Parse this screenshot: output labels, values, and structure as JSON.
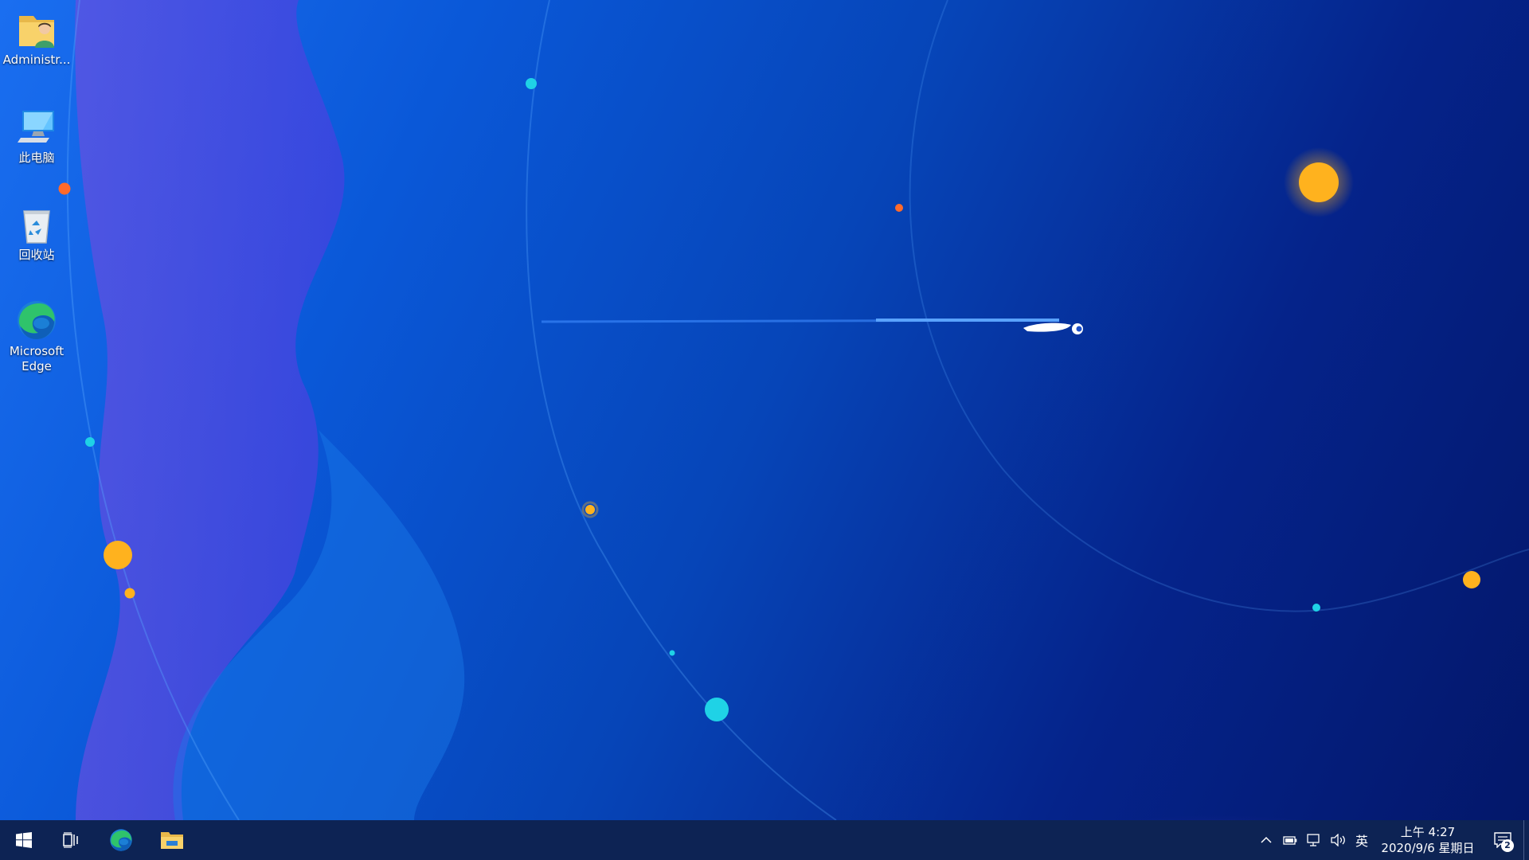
{
  "desktop": {
    "icons": [
      {
        "label": "Administr...",
        "icon": "user-folder-icon"
      },
      {
        "label": "此电脑",
        "icon": "this-pc-icon"
      },
      {
        "label": "回收站",
        "icon": "recycle-bin-icon"
      },
      {
        "label": "Microsoft Edge",
        "icon": "edge-icon"
      }
    ]
  },
  "taskbar": {
    "start": {
      "icon": "windows-logo-icon"
    },
    "task_view": {
      "icon": "task-view-icon"
    },
    "pinned": [
      {
        "icon": "edge-icon"
      },
      {
        "icon": "file-explorer-icon"
      }
    ],
    "tray": {
      "ime": "英",
      "time": "上午 4:27",
      "date": "2020/9/6 星期日",
      "notification_count": "2"
    }
  },
  "colors": {
    "taskbar": "#0d2354",
    "accent_orange": "#ffb21e",
    "accent_cyan": "#1fd2e6"
  }
}
